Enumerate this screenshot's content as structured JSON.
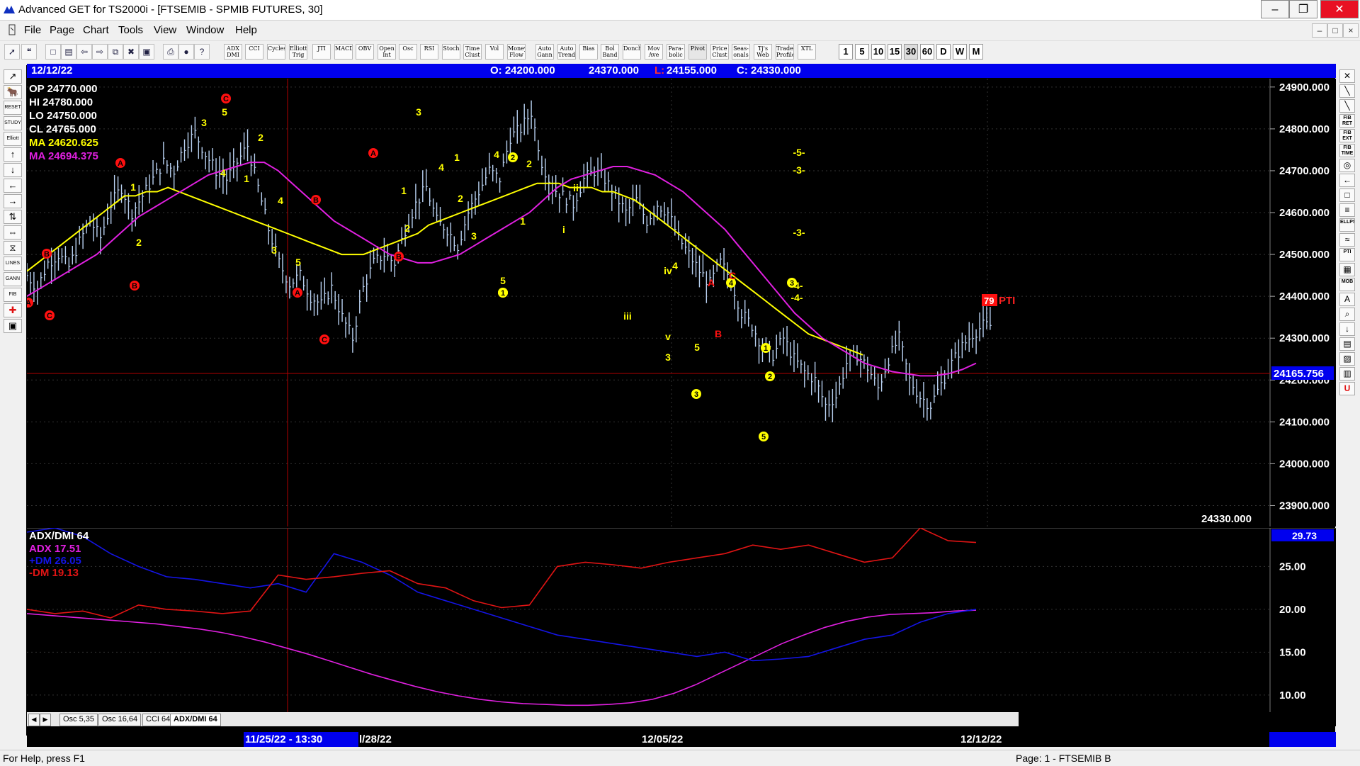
{
  "window": {
    "title": "Advanced GET for TS2000i - [FTSEMIB - SPMIB FUTURES, 30]"
  },
  "menu": [
    "File",
    "Page",
    "Chart",
    "Tools",
    "View",
    "Window",
    "Help"
  ],
  "toolbar": {
    "studies": [
      "ADX DMI",
      "CCI",
      "Cycles",
      "Elliott Trig",
      "JTI",
      "MACD",
      "OBV",
      "Open Int",
      "Osc",
      "RSI",
      "Stoch",
      "Time Clust",
      "Vol",
      "Money Flow",
      "Auto Gann",
      "Auto Trend",
      "Bias",
      "Bol Band",
      "Donch",
      "Mov Ave",
      "Para-bolic",
      "Pivot",
      "Price Clust",
      "Seas-onals",
      "Tj's Web",
      "Trade Profile",
      "XTL"
    ],
    "timeframes": [
      "1",
      "5",
      "10",
      "15",
      "30",
      "60",
      "D",
      "W",
      "M"
    ],
    "active_timeframe": "30"
  },
  "left_tools": [
    "",
    "",
    "RESET",
    "STUDY",
    "Elliott",
    "",
    "",
    "",
    "",
    "",
    "",
    "",
    "LINES",
    "GANN",
    "FIB",
    "",
    ""
  ],
  "right_tools": [
    "",
    "",
    "",
    "FIB RET",
    "FIB EXT",
    "FIB TIME",
    "",
    "",
    "",
    "",
    "ELLPS",
    "",
    "PTI",
    "",
    "MOB",
    "",
    "",
    "",
    "",
    "",
    "",
    ""
  ],
  "infobar": {
    "date": "12/12/22",
    "open": "O: 24200.000",
    "high": "24370.000",
    "low_prefix": "L:",
    "low": "24155.000",
    "close": "C: 24330.000"
  },
  "legend": {
    "op": "OP  24770.000",
    "hi": "HI   24780.000",
    "lo": "LO  24750.000",
    "cl": "CL  24765.000",
    "ma1": "MA  24620.625",
    "ma2": "MA  24694.375"
  },
  "price_axis": {
    "ticks": [
      "24900.000",
      "24800.000",
      "24700.000",
      "24600.000",
      "24500.000",
      "24400.000",
      "24300.000",
      "24200.000",
      "24100.000",
      "24000.000",
      "23900.000"
    ],
    "current": "24165.756",
    "last": "24330.000"
  },
  "pti": {
    "value": "79",
    "label": "PTI"
  },
  "osc_panel": {
    "title": "ADX/DMI 64",
    "adx": "ADX 17.51",
    "pdm": "+DM 26.05",
    "mdm": "-DM  19.13",
    "current": "29.73",
    "ticks": [
      "25.00",
      "20.00",
      "15.00",
      "10.00"
    ]
  },
  "tabs": [
    "Osc 5,35",
    "Osc 16,64",
    "CCI 64",
    "ADX/DMI 64"
  ],
  "active_tab": "ADX/DMI 64",
  "dates": {
    "cursor": "11/25/22 - 13:30",
    "d1": "l/28/22",
    "d2": "12/05/22",
    "d3": "12/12/22"
  },
  "status": {
    "left": "For Help, press F1",
    "right": "Page: 1 - FTSEMIB B"
  },
  "colors": {
    "ma_yellow": "#ffff00",
    "ma_magenta": "#e020e0",
    "bars": "#b8d0f0",
    "adx": "#e020e0",
    "pdm": "#1414e6",
    "mdm": "#e01414",
    "elliott_red": "#ff1010",
    "elliott_yellow": "#ffff00"
  },
  "chart_data": {
    "type": "line",
    "title": "FTSEMIB - SPMIB FUTURES, 30",
    "yrange": [
      23850,
      24920
    ],
    "price_series": [
      24450,
      24420,
      24480,
      24500,
      24470,
      24530,
      24580,
      24540,
      24620,
      24660,
      24600,
      24640,
      24680,
      24720,
      24700,
      24760,
      24790,
      24740,
      24700,
      24680,
      24720,
      24760,
      24660,
      24560,
      24480,
      24430,
      24450,
      24400,
      24380,
      24420,
      24350,
      24300,
      24420,
      24480,
      24500,
      24480,
      24560,
      24620,
      24660,
      24580,
      24560,
      24520,
      24600,
      24650,
      24700,
      24680,
      24780,
      24800,
      24840,
      24720,
      24660,
      24640,
      24620,
      24680,
      24700,
      24680,
      24640,
      24600,
      24630,
      24580,
      24620,
      24600,
      24540,
      24500,
      24460,
      24430,
      24480,
      24440,
      24360,
      24330,
      24280,
      24260,
      24300,
      24250,
      24220,
      24200,
      24140,
      24160,
      24240,
      24260,
      24230,
      24180,
      24250,
      24300,
      24200,
      24160,
      24140,
      24190,
      24240,
      24280,
      24310,
      24330
    ],
    "ma_yellow": [
      24460,
      24480,
      24500,
      24520,
      24540,
      24560,
      24580,
      24600,
      24620,
      24640,
      24640,
      24650,
      24650,
      24660,
      24650,
      24640,
      24630,
      24620,
      24610,
      24600,
      24590,
      24580,
      24570,
      24560,
      24550,
      24540,
      24530,
      24520,
      24510,
      24500,
      24500,
      24500,
      24510,
      24520,
      24530,
      24540,
      24550,
      24570,
      24580,
      24590,
      24600,
      24610,
      24620,
      24630,
      24640,
      24650,
      24660,
      24670,
      24670,
      24670,
      24660,
      24660,
      24660,
      24650,
      24650,
      24640,
      24630,
      24610,
      24590,
      24570,
      24550,
      24530,
      24510,
      24490,
      24470,
      24450,
      24430,
      24410,
      24390,
      24370,
      24350,
      24330,
      24310,
      24300,
      24290,
      24280,
      24270,
      24260
    ],
    "ma_magenta": [
      24400,
      24420,
      24440,
      24460,
      24480,
      24500,
      24530,
      24560,
      24590,
      24610,
      24630,
      24650,
      24670,
      24690,
      24700,
      24710,
      24720,
      24720,
      24700,
      24670,
      24640,
      24610,
      24580,
      24560,
      24540,
      24520,
      24500,
      24490,
      24480,
      24480,
      24490,
      24500,
      24520,
      24540,
      24560,
      24580,
      24600,
      24630,
      24660,
      24680,
      24690,
      24700,
      24710,
      24710,
      24700,
      24690,
      24670,
      24650,
      24620,
      24590,
      24560,
      24520,
      24480,
      24440,
      24400,
      24360,
      24330,
      24300,
      24280,
      24260,
      24240,
      24230,
      24220,
      24215,
      24210,
      24210,
      24215,
      24225,
      24240
    ],
    "osc_yrange": [
      8,
      29.5
    ],
    "adx_series": [
      19.5,
      19.3,
      19.1,
      18.9,
      18.7,
      18.5,
      18.3,
      18.0,
      17.7,
      17.3,
      16.8,
      16.2,
      15.5,
      14.8,
      14.0,
      13.2,
      12.4,
      11.7,
      11.0,
      10.4,
      9.9,
      9.5,
      9.2,
      9.0,
      8.9,
      8.8,
      8.8,
      8.9,
      9.1,
      9.5,
      10.2,
      11.2,
      12.4,
      13.6,
      14.8,
      16.0,
      17.0,
      17.9,
      18.6,
      19.1,
      19.4,
      19.5,
      19.6,
      19.8,
      19.9
    ],
    "pdm_series": [
      29.0,
      29.5,
      28.5,
      26.5,
      25.0,
      23.8,
      23.5,
      23.0,
      22.5,
      23.0,
      22.0,
      26.5,
      25.5,
      24.0,
      22.0,
      21.0,
      20.0,
      19.0,
      18.0,
      17.0,
      16.5,
      16.0,
      15.5,
      15.0,
      14.5,
      15.0,
      14.0,
      14.2,
      14.5,
      15.5,
      16.5,
      17.0,
      18.5,
      19.5,
      20.0
    ],
    "mdm_series": [
      20.0,
      19.5,
      19.8,
      19.0,
      20.5,
      20.0,
      19.8,
      19.5,
      19.8,
      24.0,
      23.5,
      23.8,
      24.2,
      24.5,
      23.0,
      22.5,
      21.0,
      20.2,
      20.5,
      25.0,
      25.5,
      25.2,
      24.8,
      25.5,
      26.0,
      26.5,
      27.5,
      27.0,
      27.5,
      26.5,
      25.5,
      26.0,
      29.5,
      28.0,
      27.8
    ]
  }
}
